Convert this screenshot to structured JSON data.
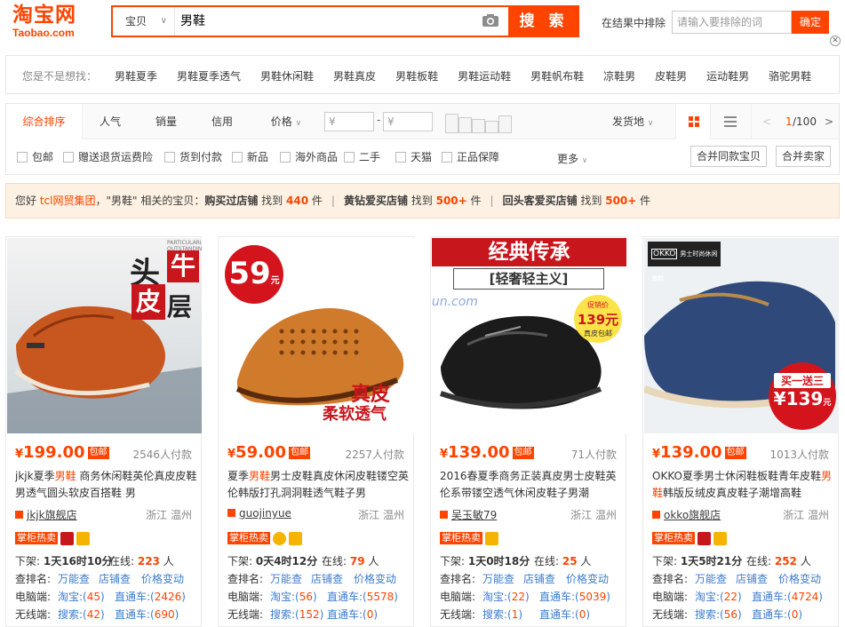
{
  "logo": {
    "cn": "淘宝网",
    "en": "Taobao.com"
  },
  "search": {
    "category": "宝贝",
    "query": "男鞋",
    "button": "搜 索",
    "exclude_label": "在结果中排除",
    "exclude_placeholder": "请输入要排除的词",
    "exclude_btn": "确定"
  },
  "suggest": {
    "label": "您是不是想找：",
    "items": [
      "男鞋夏季",
      "男鞋夏季透气",
      "男鞋休闲鞋",
      "男鞋真皮",
      "男鞋板鞋",
      "男鞋运动鞋",
      "男鞋帆布鞋",
      "凉鞋男",
      "皮鞋男",
      "运动鞋男",
      "骆驼男鞋"
    ]
  },
  "sort": {
    "tabs": [
      "综合排序",
      "人气",
      "销量",
      "信用",
      "价格"
    ],
    "price_from": "¥",
    "price_to": "¥",
    "price_dash": "-",
    "location": "发货地",
    "page_cur": "1",
    "page_total": "/100"
  },
  "filters": [
    "包邮",
    "赠送退货运费险",
    "货到付款",
    "新品",
    "海外商品",
    "二手",
    "天猫",
    "正品保障"
  ],
  "filter_more": "更多",
  "filter_buttons": [
    "合并同款宝贝",
    "合并卖家"
  ],
  "promo": {
    "hello": "您好",
    "user": "tcl网贸集团",
    "mid": "，\"男鞋\" 相关的宝贝：",
    "s1_label": "购买过店铺",
    "s1_pre": " 找到 ",
    "s1_num": "440",
    "s1_post": " 件",
    "s2_label": "黄钻爱买店铺",
    "s2_pre": " 找到 ",
    "s2_num": "500+",
    "s2_post": " 件",
    "s3_label": "回头客爱买店铺",
    "s3_pre": " 找到 ",
    "s3_num": "500+",
    "s3_post": " 件"
  },
  "labels": {
    "free_ship": "包邮",
    "counter_hot": "掌柜热卖",
    "off_shelf": "下架: ",
    "online": "在线: ",
    "online_unit": " 人",
    "row2": [
      "查排名:",
      "万能查",
      "店铺查",
      "价格变动"
    ],
    "pc": "电脑端:",
    "mobile": "无线端:",
    "taobao": "淘宝:(",
    "ztc": "直通车:(",
    "sousuo": "搜索:(",
    "close_paren": ")",
    "yen": "¥"
  },
  "products": [
    {
      "price": "199.00",
      "deals": "2546人付款",
      "title_pre": "jkjk夏季",
      "kw": "男鞋",
      "title_post": " 商务休闲鞋英伦真皮皮鞋男透气圆头软皮百搭鞋 男",
      "shop": "jkjk旗舰店",
      "loc": "浙江 温州",
      "off": "1天16时10分",
      "online": "223",
      "pc_tb": "45",
      "pc_ztc": "2426",
      "m_ss": "42",
      "m_ztc": "690",
      "img_text1": "头",
      "img_text2": "牛",
      "img_text3": "皮",
      "img_text4": "层",
      "img_tag": "PARTICULARLY OUTSTANDING"
    },
    {
      "price": "59.00",
      "deals": "2257人付款",
      "title_pre": "夏季",
      "kw": "男鞋",
      "title_post": "男士皮鞋真皮休闲皮鞋镂空英伦韩版打孔洞洞鞋透气鞋子男",
      "shop": "guojinyue",
      "loc": "浙江 温州",
      "off": "0天4时12分",
      "online": "79",
      "pc_tb": "56",
      "pc_ztc": "5578",
      "m_ss": "152",
      "m_ztc": "0",
      "img_text1": "59",
      "img_text2": "元",
      "img_text3": "真皮",
      "img_text4": "柔软透气"
    },
    {
      "price": "139.00",
      "deals": "71人付款",
      "title_pre": "2016春夏季商务正装真皮男士皮鞋英伦系带镂空透气休闲皮鞋子男潮",
      "kw": "",
      "title_post": "",
      "shop": "吴玉敏79",
      "loc": "浙江 温州",
      "off": "1天0时18分",
      "online": "25",
      "pc_tb": "22",
      "pc_ztc": "5039",
      "m_ss": "1",
      "m_ztc": "0",
      "img_text1": "经典传承",
      "img_text2": "[轻奢轻主义]",
      "img_text3": "促销价",
      "img_text4": "139元",
      "img_text5": "真皮包邮"
    },
    {
      "price": "139.00",
      "deals": "1013人付款",
      "title_pre": "OKKO夏季男士休闲鞋板鞋青年皮鞋",
      "kw": "男鞋",
      "title_post": "韩版反绒皮真皮鞋子潮增高鞋",
      "shop": "okko旗舰店",
      "loc": "浙江 温州",
      "off": "1天5时21分",
      "online": "252",
      "pc_tb": "22",
      "pc_ztc": "4724",
      "m_ss": "56",
      "m_ztc": "0",
      "img_text1": "OKKO",
      "img_text2": "男士时尚休闲潮鞋",
      "img_text3": "买一送三",
      "img_text4": "¥139",
      "img_text5": "元"
    }
  ],
  "watermark": "zhanshun.com",
  "colors": {
    "accent": "#ff4400",
    "link": "#3c7cce"
  }
}
